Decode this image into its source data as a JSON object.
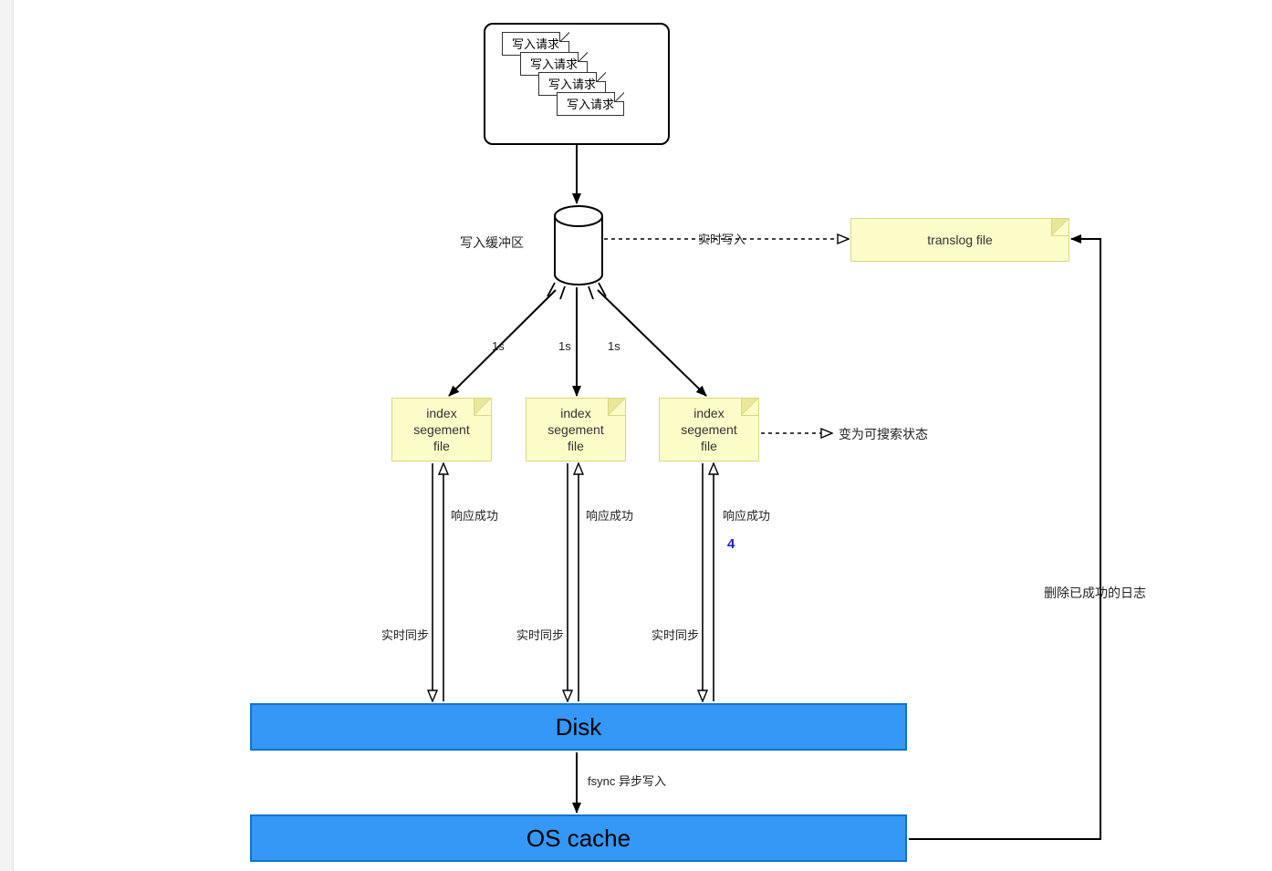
{
  "requests": {
    "r1": "写入请求",
    "r2": "写入请求",
    "r3": "写入请求",
    "r4": "写入请求"
  },
  "buffer_label": "写入缓冲区",
  "realtime_write": "实时写入",
  "translog": "translog file",
  "interval_1s": "1s",
  "segment": {
    "line1": "index",
    "line2": "segement",
    "line3": "file"
  },
  "searchable_label": "变为可搜索状态",
  "response_ok": "响应成功",
  "blue_number": "4",
  "realtime_sync": "实时同步",
  "disk": "Disk",
  "fsync_label": "fsync 异步写入",
  "oscache": "OS cache",
  "delete_log": "删除已成功的日志"
}
